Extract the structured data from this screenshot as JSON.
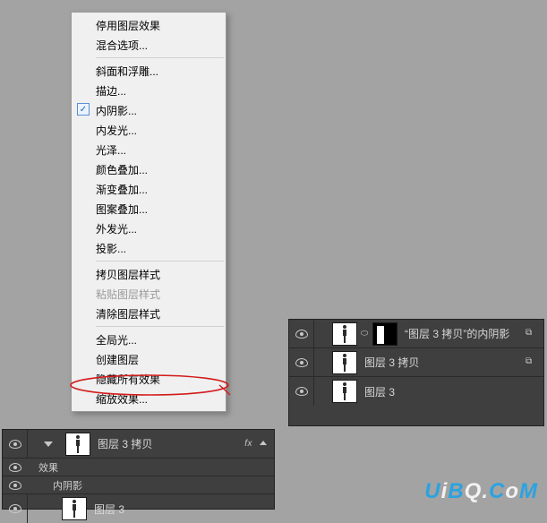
{
  "menu": {
    "items": [
      {
        "label": "停用图层效果",
        "checked": false
      },
      {
        "label": "混合选项...",
        "checked": false
      },
      {
        "sep": true
      },
      {
        "label": "斜面和浮雕...",
        "checked": false
      },
      {
        "label": "描边...",
        "checked": false
      },
      {
        "label": "内阴影...",
        "checked": true
      },
      {
        "label": "内发光...",
        "checked": false
      },
      {
        "label": "光泽...",
        "checked": false
      },
      {
        "label": "颜色叠加...",
        "checked": false
      },
      {
        "label": "渐变叠加...",
        "checked": false
      },
      {
        "label": "图案叠加...",
        "checked": false
      },
      {
        "label": "外发光...",
        "checked": false
      },
      {
        "label": "投影...",
        "checked": false
      },
      {
        "sep": true
      },
      {
        "label": "拷贝图层样式",
        "checked": false
      },
      {
        "label": "粘贴图层样式",
        "checked": false,
        "disabled": true
      },
      {
        "label": "清除图层样式",
        "checked": false
      },
      {
        "sep": true
      },
      {
        "label": "全局光...",
        "checked": false
      },
      {
        "label": "创建图层",
        "checked": false,
        "highlighted": true
      },
      {
        "label": "隐藏所有效果",
        "checked": false
      },
      {
        "label": "缩放效果...",
        "checked": false
      }
    ]
  },
  "panel_left": {
    "row1": {
      "name": "图层 3 拷贝",
      "fx_label": "fx"
    },
    "sub_effects": "效果",
    "sub_inner_shadow": "内阴影",
    "row2": {
      "name": "图层 3"
    }
  },
  "panel_right": {
    "row1": {
      "name": "图层 3 拷贝",
      "text_suffix": "的内阴影"
    },
    "row2": {
      "name": "图层 3 拷贝"
    },
    "row3": {
      "name": "图层 3"
    }
  },
  "watermark": {
    "text": "UiBQ.CoM"
  }
}
